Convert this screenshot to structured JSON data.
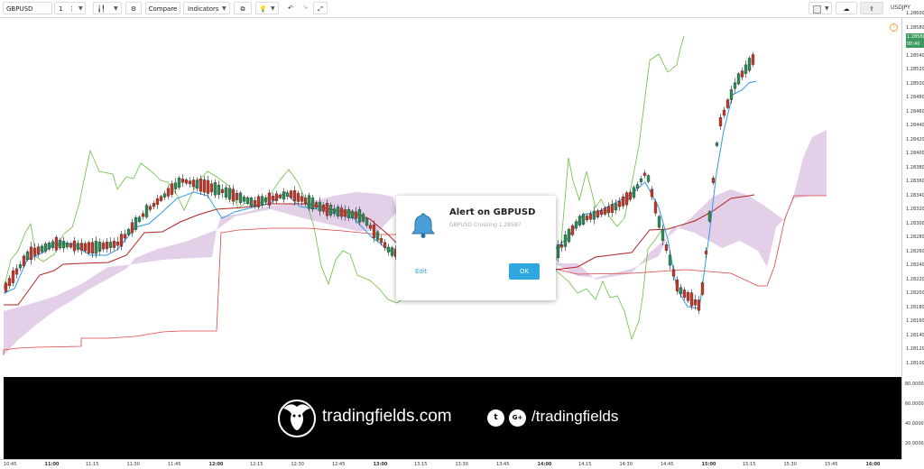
{
  "toolbar": {
    "symbol": "GBPUSD",
    "interval": "1",
    "compare_label": "Compare",
    "indicators_label": "Indicators",
    "right_symbol": "USDJPY"
  },
  "price_axis": {
    "labels": [
      "1.28600",
      "1.28580",
      "1.28560",
      "1.28540",
      "1.28520",
      "1.28500",
      "1.28480",
      "1.28460",
      "1.28440",
      "1.28420",
      "1.28400",
      "1.28380",
      "1.28360",
      "1.28340",
      "1.28320",
      "1.28300",
      "1.28280",
      "1.28260",
      "1.28240",
      "1.28220",
      "1.28200",
      "1.28180",
      "1.28160",
      "1.28140",
      "1.28120",
      "1.28100"
    ],
    "current_price": "1.28580",
    "countdown": "00:40"
  },
  "indicator_axis": {
    "labels": [
      "80.0000",
      "60.0000",
      "40.0000",
      "20.0000"
    ]
  },
  "time_axis": {
    "labels": [
      "10:45",
      "11:00",
      "11:15",
      "11:30",
      "11:45",
      "12:00",
      "12:15",
      "12:30",
      "12:45",
      "13:00",
      "13:15",
      "13:30",
      "13:45",
      "14:00",
      "14:15",
      "14:30",
      "14:45",
      "15:00",
      "15:15",
      "15:30",
      "15:45",
      "16:00"
    ]
  },
  "alert": {
    "title": "Alert on GBPUSD",
    "subtitle": "GBPUSD Crossing 1.28587",
    "edit_label": "Edit",
    "ok_label": "OK"
  },
  "banner": {
    "brand": "tradingfields.com",
    "handle": "/tradingfields",
    "twitter_glyph": "t",
    "gplus_glyph": "G+"
  },
  "colors": {
    "cloud_fill": "#e3cfe8",
    "conversion_line": "#2f9be6",
    "base_line": "#b22222",
    "lagging_span": "#6bbf3f",
    "candle_up": "#2e8b57",
    "candle_down": "#c0392b",
    "accent_blue": "#2ea6df",
    "price_tag": "#3c9a5f"
  }
}
